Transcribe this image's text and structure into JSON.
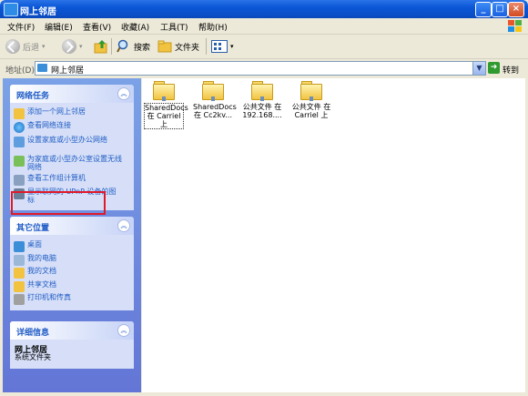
{
  "window": {
    "title": "网上邻居"
  },
  "menu": [
    "文件(F)",
    "编辑(E)",
    "查看(V)",
    "收藏(A)",
    "工具(T)",
    "帮助(H)"
  ],
  "toolbar": {
    "back": "后退",
    "search": "搜索",
    "folders": "文件夹"
  },
  "address": {
    "label": "地址(D)",
    "value": "网上邻居",
    "go": "转到"
  },
  "network_tasks": {
    "title": "网络任务",
    "items": [
      "添加一个网上邻居",
      "查看网络连接",
      "设置家庭或小型办公网络",
      "为家庭或小型办公室设置无线网络",
      "查看工作组计算机",
      "显示联网的 UPnP 设备的图标"
    ]
  },
  "other_places": {
    "title": "其它位置",
    "items": [
      "桌面",
      "我的电脑",
      "我的文档",
      "共享文档",
      "打印机和传真"
    ]
  },
  "details": {
    "title": "详细信息",
    "name": "网上邻居",
    "type": "系统文件夹"
  },
  "shares": [
    {
      "line1": "SharedDocs",
      "line2": "在 Carriel",
      "line3": "上"
    },
    {
      "line1": "SharedDocs",
      "line2": "在 Cc2kv...",
      "line3": ""
    },
    {
      "line1": "公共文件 在",
      "line2": "192.168....",
      "line3": ""
    },
    {
      "line1": "公共文件 在",
      "line2": "Carriel 上",
      "line3": ""
    }
  ],
  "colors": {
    "accent": "#215dc6",
    "highlight": "#e0192a"
  }
}
